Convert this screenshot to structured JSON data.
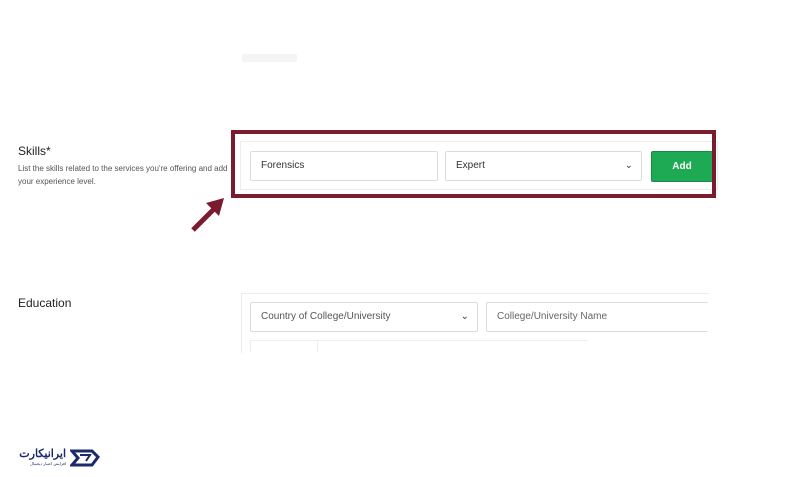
{
  "skills": {
    "title": "Skills*",
    "description": "List the skills related to the services you're offering and add your experience level.",
    "skill_value": "Forensics",
    "level_value": "Expert",
    "add_label": "Add"
  },
  "education": {
    "title": "Education",
    "country_placeholder": "Country of College/University",
    "university_placeholder": "College/University Name"
  },
  "logo": {
    "name": "ایرانیکارت",
    "tagline": "افزایش اعتبار دیجیتال"
  },
  "colors": {
    "highlight": "#7a1c2e",
    "accent_green": "#1eaa54",
    "logo_blue": "#1b2a6b"
  },
  "icons": [
    "chevron-down-icon",
    "arrow-icon",
    "logo-mark-icon"
  ]
}
